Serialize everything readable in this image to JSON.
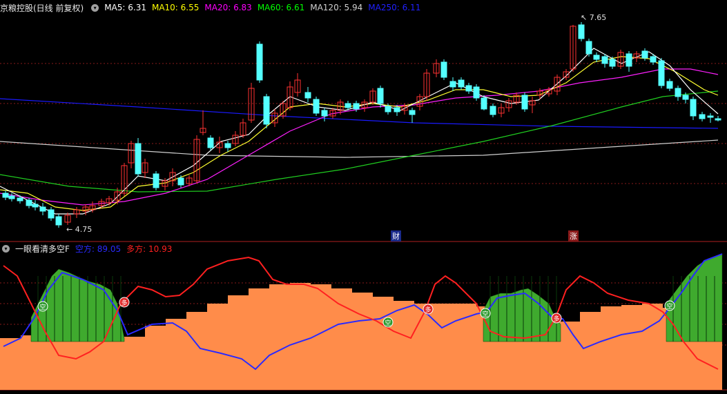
{
  "main_panel": {
    "title": "京粮控股(日线 前复权)",
    "ma_labels": [
      {
        "text": "MA5: 6.31",
        "color": "#ffffff"
      },
      {
        "text": "MA10: 6.55",
        "color": "#ffff00"
      },
      {
        "text": "MA20: 6.83",
        "color": "#ff00ff"
      },
      {
        "text": "MA60: 6.61",
        "color": "#00ff00"
      },
      {
        "text": "MA120: 5.94",
        "color": "#d0d0d0"
      },
      {
        "text": "MA250: 6.11",
        "color": "#0000ff"
      }
    ],
    "high_label": "7.65",
    "low_label": "4.75",
    "event_markers": [
      "财",
      "涨"
    ]
  },
  "indicator_panel": {
    "title": "一眼看清多空F",
    "kong_label": "空方: 89.05",
    "duo_label": "多方: 10.93",
    "kong_color": "#2a2aff",
    "duo_color": "#ff2020",
    "badges": [
      {
        "text": "空",
        "type": "kong"
      },
      {
        "text": "多",
        "type": "duo"
      },
      {
        "text": "空",
        "type": "kong"
      },
      {
        "text": "多",
        "type": "duo"
      },
      {
        "text": "空",
        "type": "kong"
      },
      {
        "text": "多",
        "type": "duo"
      },
      {
        "text": "空",
        "type": "kong"
      }
    ]
  },
  "colors": {
    "up_candle": "#ff3232",
    "down_candle": "#54ffff",
    "area_fill": "#ff8c4a",
    "green_hist": "#3faa2e",
    "grid": "#8a1a1a"
  }
}
